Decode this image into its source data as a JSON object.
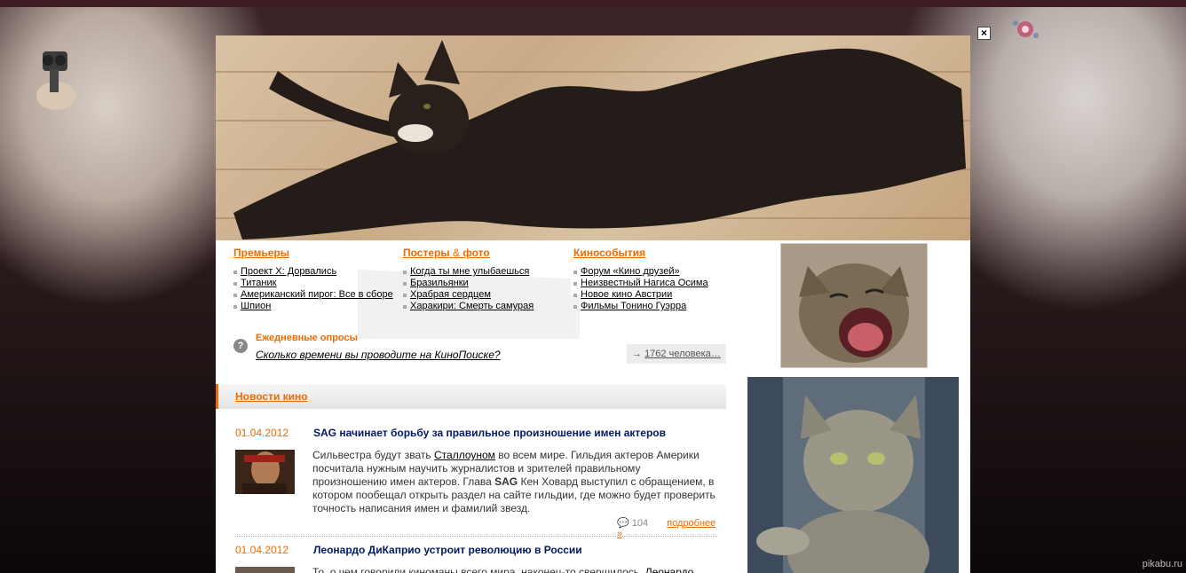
{
  "watermark": "pikabu.ru",
  "close_label": "×",
  "columns": [
    {
      "title": "Премьеры",
      "items": [
        "Проект X: Дорвались",
        "Титаник",
        "Американский пирог: Все в сборе",
        "Шпион"
      ]
    },
    {
      "title_a": "Постеры",
      "amp": "&",
      "title_b": "фото",
      "items": [
        "Когда ты мне улыбаешься",
        "Бразильянки",
        "Храбрая сердцем",
        "Харакири: Смерть самурая"
      ]
    },
    {
      "title": "Кинособытия",
      "items": [
        "Форум «Кино друзей»",
        "Неизвестный Нагиса Осима",
        "Новое кино Австрии",
        "Фильмы Тонино Гуэрра"
      ]
    }
  ],
  "poll": {
    "icon": "?",
    "title": "Ежедневные опросы",
    "question": "Сколько времени вы проводите на КиноПоиске?",
    "arrow": "→",
    "count": "1762 человека…"
  },
  "news": {
    "section_title": "Новости кино",
    "items": [
      {
        "date": "01.04.2012",
        "title": "SAG начинает борьбу за правильное произношение имен актеров",
        "body_1": "Сильвестра будут звать ",
        "body_link": "Сталлоуном",
        "body_2": " во всем мире. Гильдия актеров Америки посчитала нужным научить журналистов и зрителей правильному произношению имен актеров. Глава ",
        "body_bold": "SAG",
        "body_3": " Кен Ховард выступил с обращением, в котором пообещал открыть раздел на сайте гильдии, где можно будет проверить точность написания имен и фамилий звезд.",
        "comments": "104",
        "more": "подробнее »"
      },
      {
        "date": "01.04.2012",
        "title": "Леонардо ДиКаприо устроит революцию в России",
        "body_1": "То, о чем говорили киноманы всего мира, наконец-то свершилось. ",
        "body_link": "Леонардо"
      }
    ]
  }
}
